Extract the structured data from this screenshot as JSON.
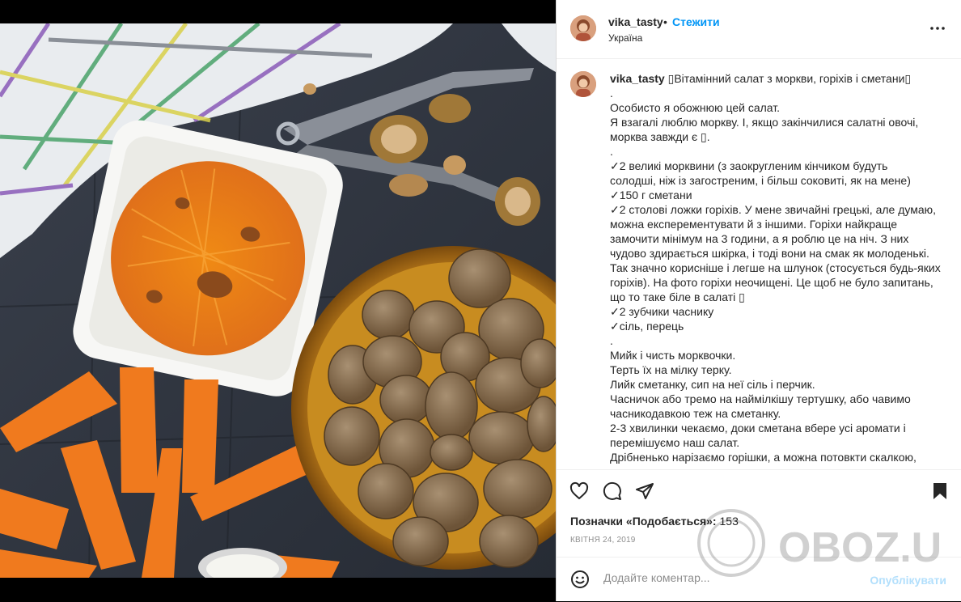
{
  "header": {
    "username": "vika_tasty",
    "separator": "•",
    "follow_label": "Стежити",
    "location": "Україна"
  },
  "caption": {
    "username": "vika_tasty",
    "lines": [
      "▯Вітамінний салат з моркви, горіхів і сметани▯",
      ".",
      "Особисто я обожнюю цей салат.",
      "Я взагалі люблю моркву. І, якщо закінчилися салатні овочі,",
      "морква завжди є ▯.",
      ".",
      "✓2 великі морквини (з заокругленим кінчиком будуть",
      "солодші, ніж із загостреним, і більш соковиті, як на мене)",
      "✓150 г сметани",
      "✓2 столові ложки горіхів. У мене звичайні грецькі, але думаю,",
      "можна експерементувати й з іншими. Горіхи найкраще",
      "замочити мінімум на 3 години, а я роблю це на ніч. З них",
      "чудово здирається шкірка, і тоді вони на смак як молоденькі.",
      "Так значно корисніше і легше на шлунок (стосується будь-яких",
      "горіхів). На фото горіхи неочищені. Це щоб не було запитань,",
      "що то таке біле в салаті ▯",
      "✓2 зубчики часнику",
      "✓сіль, перець",
      ".",
      "Мийк і чисть морквочки.",
      "Терть їх на мілку терку.",
      "Лийк сметанку, сип на неї сіль і перчик.",
      "Часничок або тремо на наймілкішу тертушку, або чавимо",
      "часникодавкою теж на сметанку.",
      "2-3 хвилинки чекаємо, доки сметана вбере усі аромати і",
      "перемішуємо наш салат.",
      "Дрібненько нарізаємо горішки, а можна потовкти скалкою,"
    ]
  },
  "actions": {
    "likes_label": "Позначки «Подобається»:",
    "likes_count": "153",
    "date": "КВІТНЯ 24, 2019"
  },
  "comment": {
    "placeholder": "Додайте коментар...",
    "post_label": "Опублікувати"
  },
  "watermark": {
    "text": "OBOZ.UA"
  },
  "colors": {
    "accent": "#0095f6",
    "post_disabled": "#b2dffc",
    "text": "#262626",
    "muted": "#8e8e8e"
  }
}
